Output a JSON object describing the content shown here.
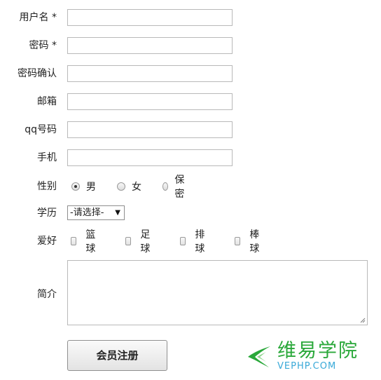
{
  "form": {
    "username": {
      "label": "用户名 *",
      "value": ""
    },
    "password": {
      "label": "密码 *",
      "value": ""
    },
    "confirm_password": {
      "label": "密码确认",
      "value": ""
    },
    "email": {
      "label": "邮箱",
      "value": ""
    },
    "qq": {
      "label": "qq号码",
      "value": ""
    },
    "phone": {
      "label": "手机",
      "value": ""
    },
    "gender": {
      "label": "性别",
      "options": [
        "男",
        "女",
        "保密"
      ],
      "selected": "男"
    },
    "education": {
      "label": "学历",
      "selected_text": "-请选择-"
    },
    "hobbies": {
      "label": "爱好",
      "options": [
        "篮球",
        "足球",
        "排球",
        "棒球"
      ],
      "checked": []
    },
    "intro": {
      "label": "简介",
      "value": ""
    },
    "submit_label": "会员注册"
  },
  "watermark": {
    "title": "维易学院",
    "url": "VEPHP.COM",
    "accent_green": "#2aa83a",
    "accent_blue": "#39a9d8"
  }
}
